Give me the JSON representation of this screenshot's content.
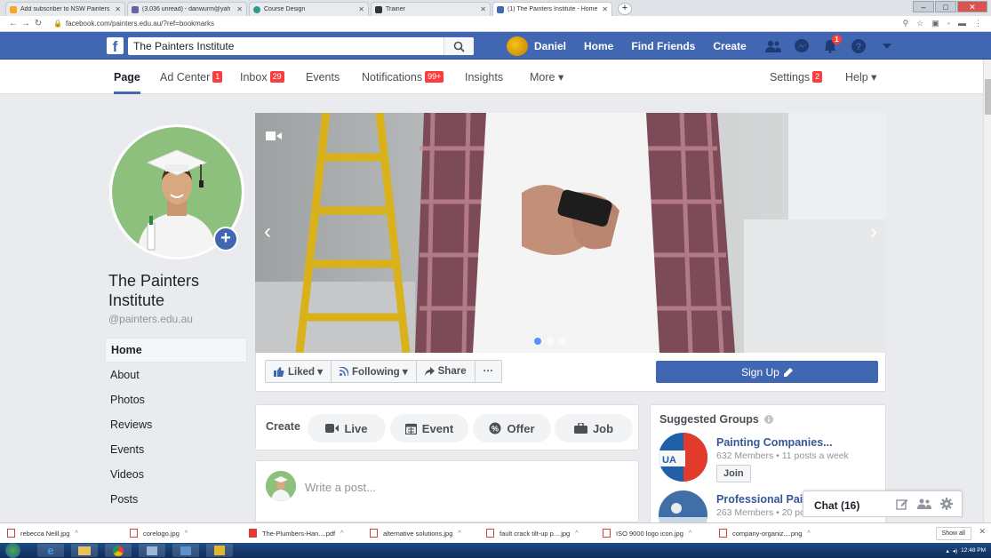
{
  "browser": {
    "tabs": [
      {
        "title": "Add subscriber to NSW Painters",
        "color": "#f5a623"
      },
      {
        "title": "(3,036 unread) - danwurm@yah",
        "color": "#6264a7"
      },
      {
        "title": "Course Design",
        "color": "#2a9d8f"
      },
      {
        "title": "Trainer",
        "color": "#333333"
      },
      {
        "title": "(1) The Painters Institute - Home",
        "color": "#4267b2",
        "active": true
      }
    ],
    "url": "facebook.com/painters.edu.au/?ref=bookmarks"
  },
  "fb": {
    "search_value": "The Painters Institute",
    "user_name": "Daniel",
    "nav_home": "Home",
    "nav_find_friends": "Find Friends",
    "nav_create": "Create",
    "notif_count": "1"
  },
  "pagenav": {
    "page": "Page",
    "ad_center": "Ad Center",
    "ad_center_badge": "1",
    "inbox": "Inbox",
    "inbox_badge": "29",
    "events": "Events",
    "notifications": "Notifications",
    "notifications_badge": "99+",
    "insights": "Insights",
    "more": "More ▾",
    "settings": "Settings",
    "settings_badge": "2",
    "help": "Help ▾"
  },
  "profile": {
    "name": "The Painters Institute",
    "handle": "@painters.edu.au"
  },
  "side_menu": [
    "Home",
    "About",
    "Photos",
    "Reviews",
    "Events",
    "Videos",
    "Posts"
  ],
  "actions": {
    "liked": "Liked ▾",
    "following": "Following ▾",
    "share": "Share",
    "more": "···",
    "signup": "Sign Up"
  },
  "create": {
    "label": "Create",
    "live": "Live",
    "event": "Event",
    "offer": "Offer",
    "job": "Job"
  },
  "write": {
    "placeholder": "Write a post..."
  },
  "suggested": {
    "title": "Suggested Groups",
    "groups": [
      {
        "name": "Painting Companies...",
        "meta": "632 Members • 11 posts a week",
        "join": "Join"
      },
      {
        "name": "Professional Pair",
        "meta": "263 Members • 20 po"
      }
    ]
  },
  "chat": {
    "label": "Chat (16)"
  },
  "downloads": {
    "items": [
      {
        "name": "rebecca Neill.jpg"
      },
      {
        "name": "corelogo.jpg"
      },
      {
        "name": "The-Plumbers-Han....pdf",
        "pdf": true
      },
      {
        "name": "alternative solutions.jpg"
      },
      {
        "name": "fault crack tilt-up p....jpg"
      },
      {
        "name": "ISO 9000 logo icon.jpg"
      },
      {
        "name": "company-organiz....png"
      }
    ],
    "show_all": "Show all"
  },
  "taskbar": {
    "time": "12:48 PM"
  },
  "colors": {
    "fb_blue": "#4267b2",
    "badge_red": "#fa3e3e",
    "link_blue": "#365899"
  }
}
